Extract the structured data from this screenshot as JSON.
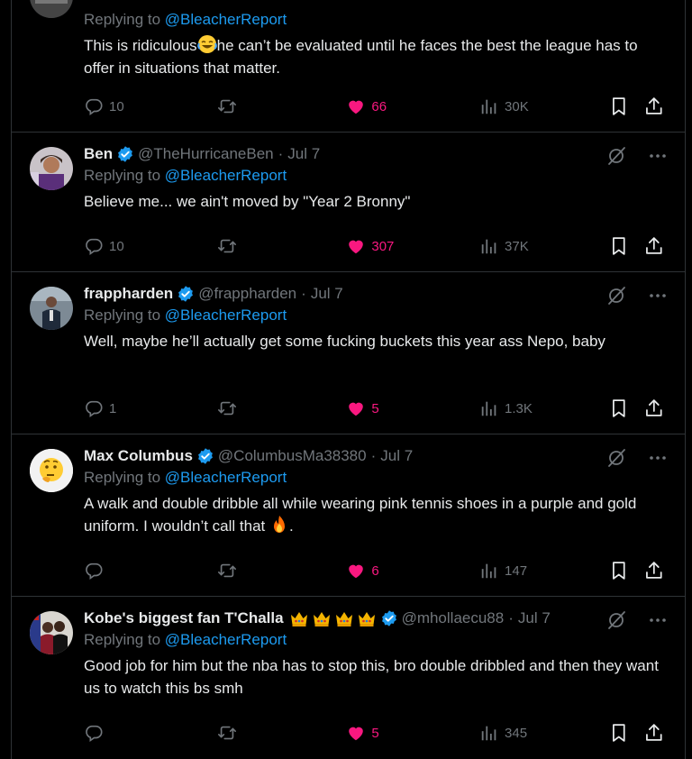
{
  "accent": "#1d9bf0",
  "like_color": "#f91880",
  "replying_prefix": "Replying to",
  "posts": [
    {
      "replying_to": "@BleacherReport",
      "text_a": "This is ridiculous",
      "emoji": "face-with-tears-of-joy",
      "text_b": "he can’t be evaluated until he faces the best the league has to offer in situations that matter.",
      "replies": "10",
      "likes": "66",
      "views": "30K"
    },
    {
      "name": "Ben",
      "handle": "@TheHurricaneBen",
      "sep": "·",
      "date": "Jul 7",
      "replying_to": "@BleacherReport",
      "text": "Believe me... we ain't moved by \"Year 2 Bronny\"",
      "replies": "10",
      "likes": "307",
      "views": "37K"
    },
    {
      "name": "frappharden",
      "handle": "@frappharden",
      "sep": "·",
      "date": "Jul 7",
      "replying_to": "@BleacherReport",
      "text": "Well, maybe he’ll actually get some fucking buckets this year ass Nepo, baby",
      "replies": "1",
      "likes": "5",
      "views": "1.3K"
    },
    {
      "name": "Max Columbus",
      "handle": "@ColumbusMa38380",
      "sep": "·",
      "date": "Jul 7",
      "replying_to": "@BleacherReport",
      "text_a": "A walk and double dribble all while wearing pink tennis shoes in a purple and gold uniform.  I wouldn’t call that",
      "emoji": "fire",
      "text_b": ".",
      "replies": "",
      "likes": "6",
      "views": "147"
    },
    {
      "name": "Kobe's biggest fan T'Challa",
      "name_emoji": "crown x4",
      "handle": "@mhollaecu88",
      "sep": "·",
      "date": "Jul 7",
      "replying_to": "@BleacherReport",
      "text": "Good job for him but the nba has to stop this, bro double dribbled and then they want us to watch this bs smh",
      "replies": "",
      "likes": "5",
      "views": "345"
    }
  ]
}
